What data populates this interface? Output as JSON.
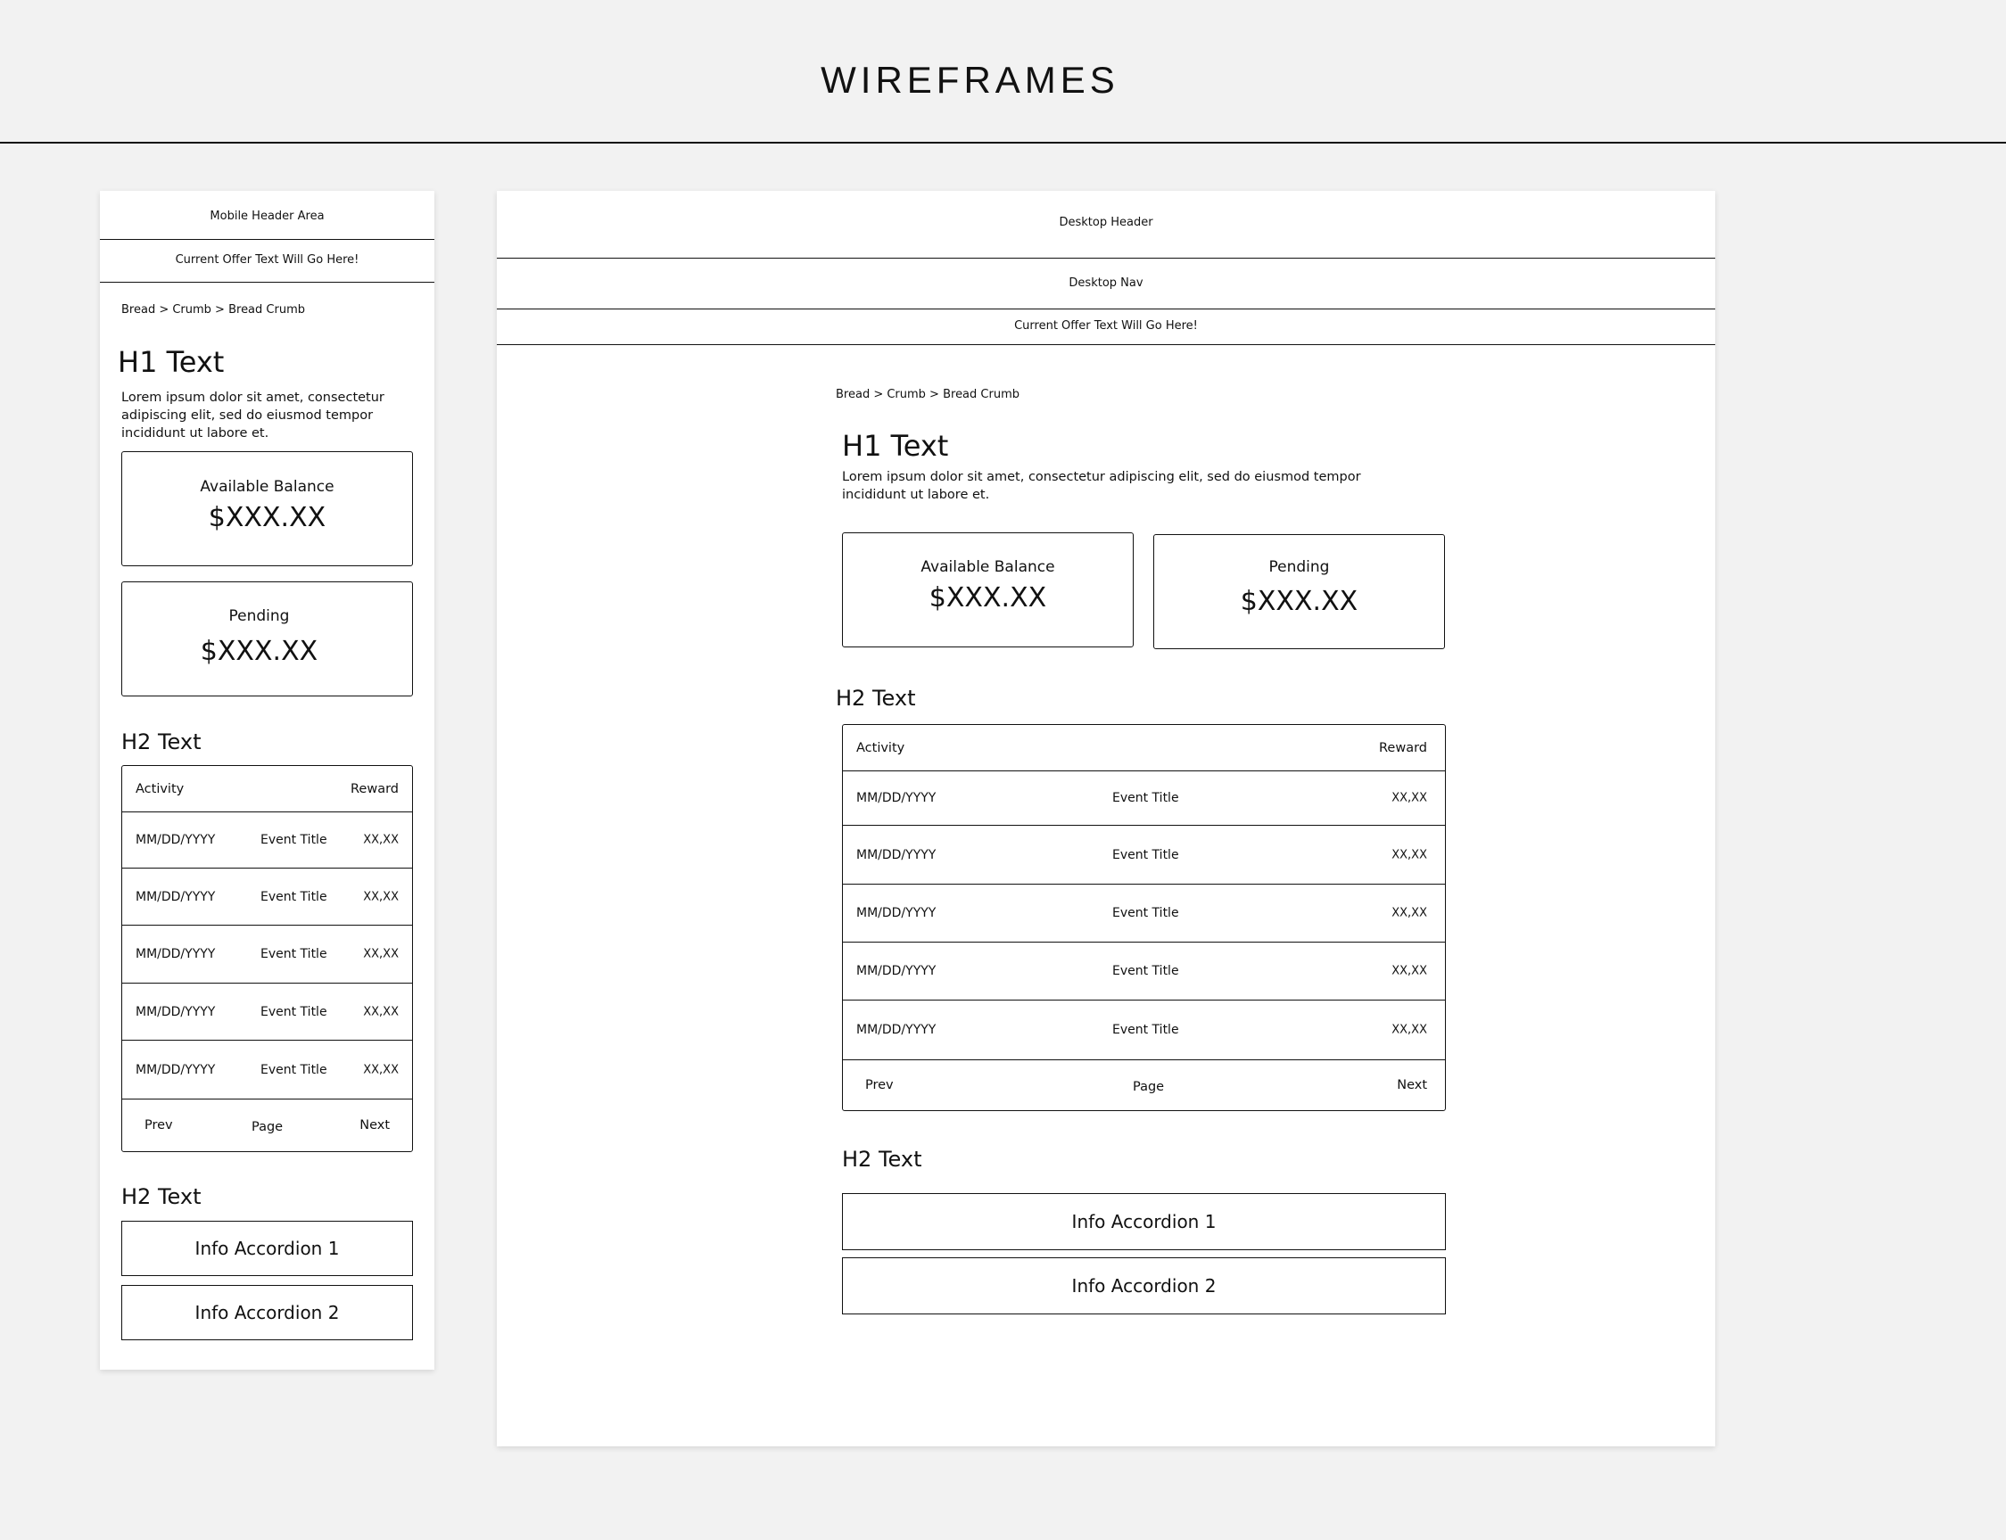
{
  "page_title": "WIREFRAMES",
  "mobile": {
    "header": "Mobile Header Area",
    "offer": "Current Offer Text Will Go Here!",
    "breadcrumb": "Bread > Crumb > Bread Crumb",
    "h1": "H1 Text",
    "intro": "Lorem ipsum dolor sit amet, consectetur adipiscing elit, sed do eiusmod tempor incididunt ut labore et.",
    "balance": {
      "label": "Available Balance",
      "value": "$XXX.XX"
    },
    "pending": {
      "label": "Pending",
      "value": "$XXX.XX"
    },
    "h2_activity": "H2 Text",
    "table": {
      "col_activity": "Activity",
      "col_reward": "Reward",
      "rows": [
        {
          "date": "MM/DD/YYYY",
          "event": "Event Title",
          "reward": "XX,XX"
        },
        {
          "date": "MM/DD/YYYY",
          "event": "Event Title",
          "reward": "XX,XX"
        },
        {
          "date": "MM/DD/YYYY",
          "event": "Event Title",
          "reward": "XX,XX"
        },
        {
          "date": "MM/DD/YYYY",
          "event": "Event Title",
          "reward": "XX,XX"
        },
        {
          "date": "MM/DD/YYYY",
          "event": "Event Title",
          "reward": "XX,XX"
        }
      ],
      "prev": "Prev",
      "page": "Page",
      "next": "Next"
    },
    "h2_info": "H2 Text",
    "accordions": [
      "Info Accordion 1",
      "Info Accordion 2"
    ]
  },
  "desktop": {
    "header": "Desktop Header",
    "nav": "Desktop Nav",
    "offer": "Current Offer Text Will Go Here!",
    "breadcrumb": "Bread > Crumb > Bread Crumb",
    "h1": "H1 Text",
    "intro_line1": "Lorem ipsum dolor sit amet, consectetur adipiscing elit, sed do eiusmod tempor",
    "intro_line2": "incididunt ut labore et.",
    "balance": {
      "label": "Available Balance",
      "value": "$XXX.XX"
    },
    "pending": {
      "label": "Pending",
      "value": "$XXX.XX"
    },
    "h2_activity": "H2 Text",
    "table": {
      "col_activity": "Activity",
      "col_reward": "Reward",
      "rows": [
        {
          "date": "MM/DD/YYYY",
          "event": "Event Title",
          "reward": "XX,XX"
        },
        {
          "date": "MM/DD/YYYY",
          "event": "Event Title",
          "reward": "XX,XX"
        },
        {
          "date": "MM/DD/YYYY",
          "event": "Event Title",
          "reward": "XX,XX"
        },
        {
          "date": "MM/DD/YYYY",
          "event": "Event Title",
          "reward": "XX,XX"
        },
        {
          "date": "MM/DD/YYYY",
          "event": "Event Title",
          "reward": "XX,XX"
        }
      ],
      "prev": "Prev",
      "page": "Page",
      "next": "Next"
    },
    "h2_info": "H2 Text",
    "accordions": [
      "Info Accordion 1",
      "Info Accordion 2"
    ]
  }
}
